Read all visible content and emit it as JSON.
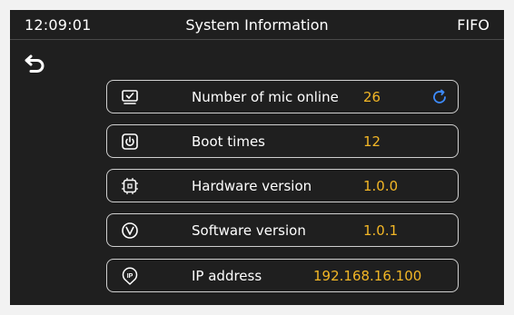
{
  "status_bar": {
    "time": "12:09:01",
    "title": "System Information",
    "mode": "FIFO"
  },
  "colors": {
    "background": "#1f1f1f",
    "value_accent": "#f2b626",
    "refresh_accent": "#3d8bff",
    "row_border": "#cfcfcf"
  },
  "rows": [
    {
      "icon": "monitor-check-icon",
      "label": "Number of mic online",
      "value": "26",
      "action_icon": "refresh-icon"
    },
    {
      "icon": "power-icon",
      "label": "Boot times",
      "value": "12"
    },
    {
      "icon": "chip-icon",
      "label": "Hardware version",
      "value": "1.0.0"
    },
    {
      "icon": "software-v-icon",
      "label": "Software version",
      "value": "1.0.1"
    },
    {
      "icon": "ip-pin-icon",
      "label": "IP address",
      "value": "192.168.16.100"
    }
  ]
}
